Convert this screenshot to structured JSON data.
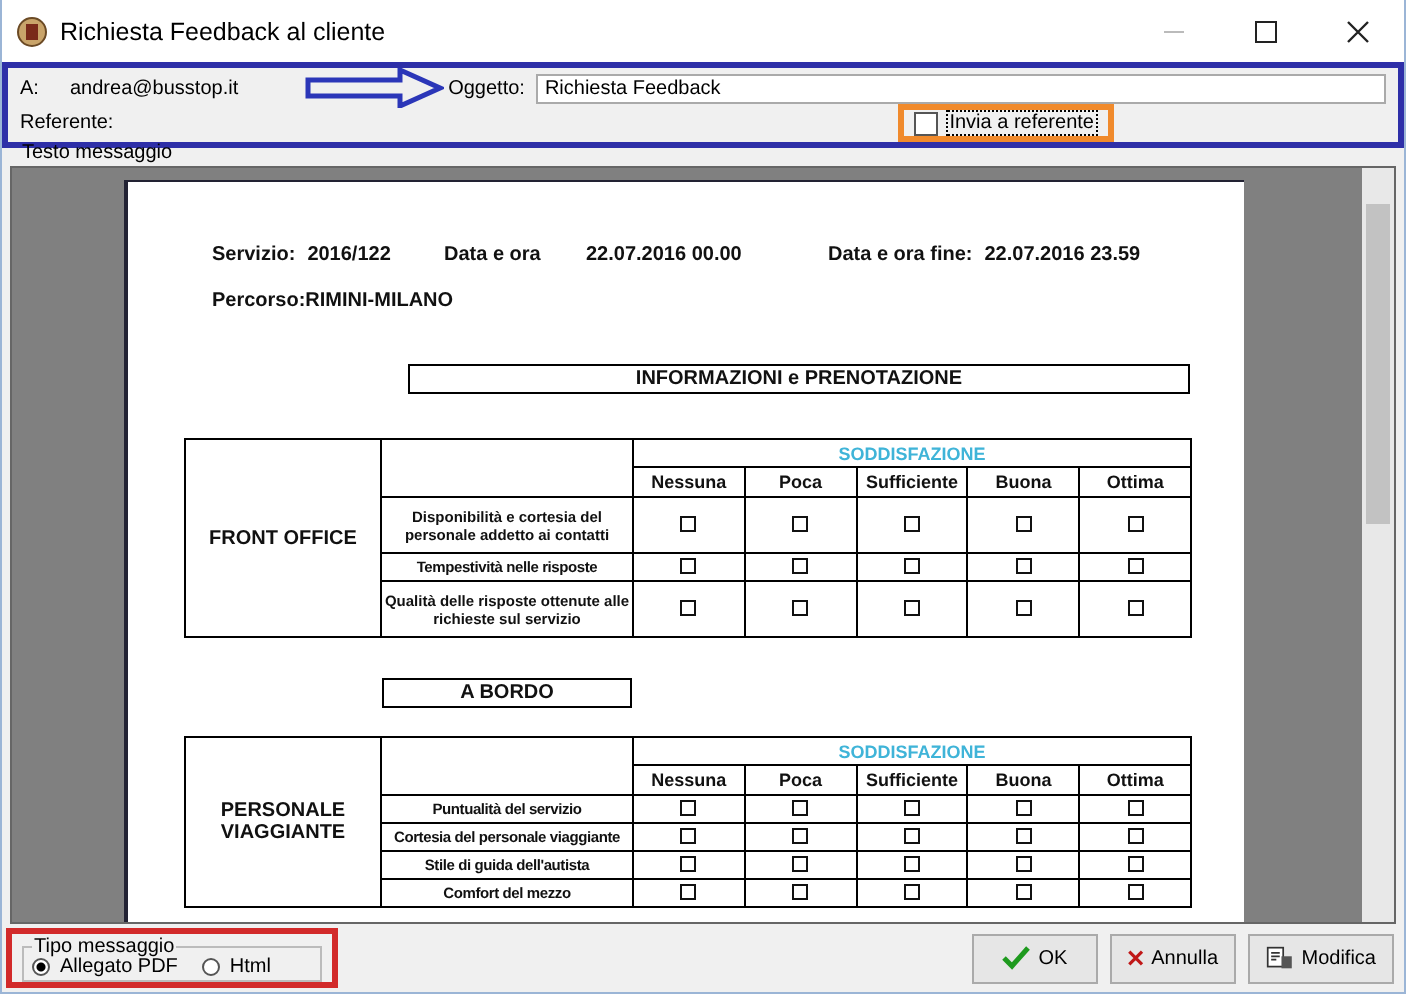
{
  "window": {
    "title": "Richiesta Feedback al cliente"
  },
  "header": {
    "to_label": "A:",
    "to": "andrea@busstop.it",
    "referent_label": "Referente:",
    "subject_label": "Oggetto:",
    "subject": "Richiesta Feedback",
    "send_to_referent": {
      "label": "Invia a referente",
      "checked": false
    }
  },
  "body_label": "Testo messaggio",
  "document": {
    "info": [
      {
        "label": "Servizio:",
        "value": "2016/122"
      },
      {
        "label": "Data e ora",
        "value": "22.07.2016 00.00"
      },
      {
        "label": "Data e ora fine:",
        "value": "22.07.2016 23.59"
      }
    ],
    "route": "Percorso:RIMINI-MILANO",
    "sections": [
      {
        "title": "INFORMAZIONI e PRENOTAZIONE",
        "group": "FRONT OFFICE",
        "scale_title": "SODDISFAZIONE",
        "levels": [
          "Nessuna",
          "Poca",
          "Sufficiente",
          "Buona",
          "Ottima"
        ],
        "rows": [
          {
            "question": "Disponibilità e cortesia del personale addetto ai contatti",
            "kind": "tall",
            "checked": [
              false,
              false,
              false,
              false,
              false
            ]
          },
          {
            "question": "Tempestività nelle risposte",
            "kind": "small",
            "checked": [
              false,
              false,
              false,
              false,
              false
            ]
          },
          {
            "question": "Qualità delle risposte ottenute alle richieste sul servizio",
            "kind": "tall",
            "checked": [
              false,
              false,
              false,
              false,
              false
            ]
          }
        ]
      },
      {
        "title": "A BORDO",
        "group": "PERSONALE VIAGGIANTE",
        "scale_title": "SODDISFAZIONE",
        "levels": [
          "Nessuna",
          "Poca",
          "Sufficiente",
          "Buona",
          "Ottima"
        ],
        "rows": [
          {
            "question": "Puntualità del servizio",
            "kind": "small",
            "checked": [
              false,
              false,
              false,
              false,
              false
            ]
          },
          {
            "question": "Cortesia del personale viaggiante",
            "kind": "small",
            "checked": [
              false,
              false,
              false,
              false,
              false
            ]
          },
          {
            "question": "Stile di guida dell'autista",
            "kind": "small",
            "checked": [
              false,
              false,
              false,
              false,
              false
            ]
          },
          {
            "question": "Comfort del mezzo",
            "kind": "small",
            "checked": [
              false,
              false,
              false,
              false,
              false
            ]
          }
        ]
      }
    ]
  },
  "message_type": {
    "label": "Tipo messaggio",
    "options": [
      {
        "label": "Allegato PDF",
        "selected": true
      },
      {
        "label": "Html",
        "selected": false
      }
    ]
  },
  "buttons": [
    {
      "label": "OK",
      "kind": "ok"
    },
    {
      "label": "Annulla",
      "kind": "cancel"
    },
    {
      "label": "Modifica",
      "kind": "edit"
    }
  ]
}
